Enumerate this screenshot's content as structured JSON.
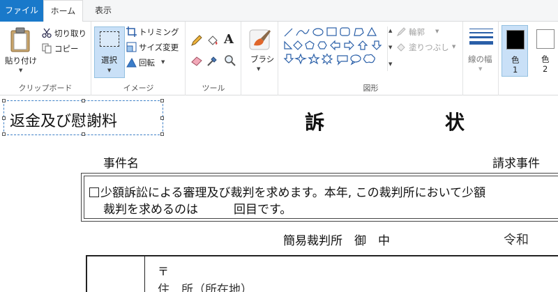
{
  "tabs": {
    "file": "ファイル",
    "home": "ホーム",
    "view": "表示"
  },
  "clipboard": {
    "paste": "貼り付け",
    "cut": "切り取り",
    "copy": "コピー",
    "label": "クリップボード"
  },
  "image": {
    "select": "選択",
    "crop": "トリミング",
    "resize": "サイズ変更",
    "rotate": "回転",
    "label": "イメージ"
  },
  "tools": {
    "label": "ツール"
  },
  "brushes": {
    "label": "ブラシ"
  },
  "shapes": {
    "outline": "輪郭",
    "fill": "塗りつぶし",
    "label": "図形"
  },
  "size": {
    "label": "線の幅"
  },
  "colors": {
    "color1_label": "色",
    "color1_num": "1",
    "color2_label": "色",
    "color2_num": "2",
    "color1_value": "#000000",
    "color2_value": "#ffffff"
  },
  "document": {
    "header_left": "返金及び慰謝料",
    "title_left": "訴",
    "title_right": "状",
    "case_name_label": "事件名",
    "claim_case_label": "請求事件",
    "claim_line1": "少額訴訟による審理及び裁判を求めます。本年,  この裁判所において少額",
    "claim_line2": "裁判を求めるのは　　　回目です。",
    "court": "簡易裁判所　御　中",
    "era": "令和",
    "postal": "〒",
    "address": "住　所（所在地）"
  }
}
